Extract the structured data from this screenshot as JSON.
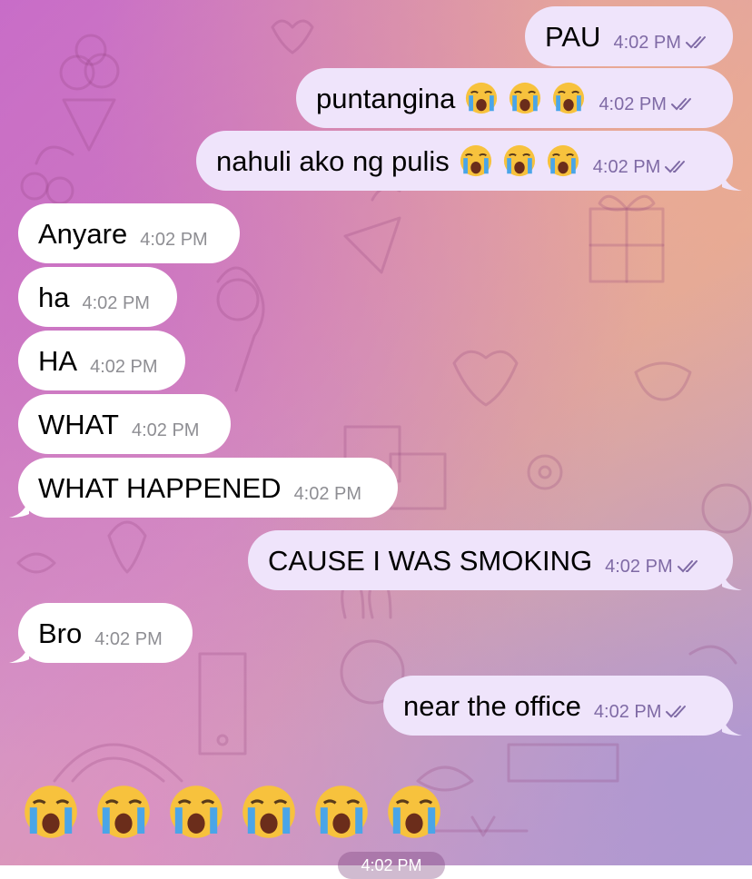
{
  "chat": {
    "messages": [
      {
        "id": "m1",
        "direction": "out",
        "text": "PAU",
        "emoji_count": 0,
        "time": "4:02 PM",
        "status": "read"
      },
      {
        "id": "m2",
        "direction": "out",
        "text": "puntangina",
        "emoji_count": 3,
        "emoji": "loudly-crying-face",
        "time": "4:02 PM",
        "status": "read"
      },
      {
        "id": "m3",
        "direction": "out",
        "text": "nahuli ako ng pulis",
        "emoji_count": 3,
        "emoji": "loudly-crying-face",
        "time": "4:02 PM",
        "status": "read"
      },
      {
        "id": "m4",
        "direction": "in",
        "text": "Anyare",
        "emoji_count": 0,
        "time": "4:02 PM"
      },
      {
        "id": "m5",
        "direction": "in",
        "text": "ha",
        "emoji_count": 0,
        "time": "4:02 PM"
      },
      {
        "id": "m6",
        "direction": "in",
        "text": "HA",
        "emoji_count": 0,
        "time": "4:02 PM"
      },
      {
        "id": "m7",
        "direction": "in",
        "text": "WHAT",
        "emoji_count": 0,
        "time": "4:02 PM"
      },
      {
        "id": "m8",
        "direction": "in",
        "text": "WHAT HAPPENED",
        "emoji_count": 0,
        "time": "4:02 PM"
      },
      {
        "id": "m9",
        "direction": "out",
        "text": "CAUSE I WAS SMOKING",
        "emoji_count": 0,
        "time": "4:02 PM",
        "status": "read"
      },
      {
        "id": "m10",
        "direction": "in",
        "text": "Bro",
        "emoji_count": 0,
        "time": "4:02 PM"
      },
      {
        "id": "m11",
        "direction": "out",
        "text": "near the office",
        "emoji_count": 0,
        "time": "4:02 PM",
        "status": "read"
      }
    ],
    "emoji_only_message": {
      "emoji": "loudly-crying-face",
      "count": 6
    },
    "date_pill": "4:02 PM"
  },
  "colors": {
    "outgoing_bubble": "#efe4fb",
    "incoming_bubble": "#ffffff",
    "read_ticks": "#7f6aa5"
  }
}
